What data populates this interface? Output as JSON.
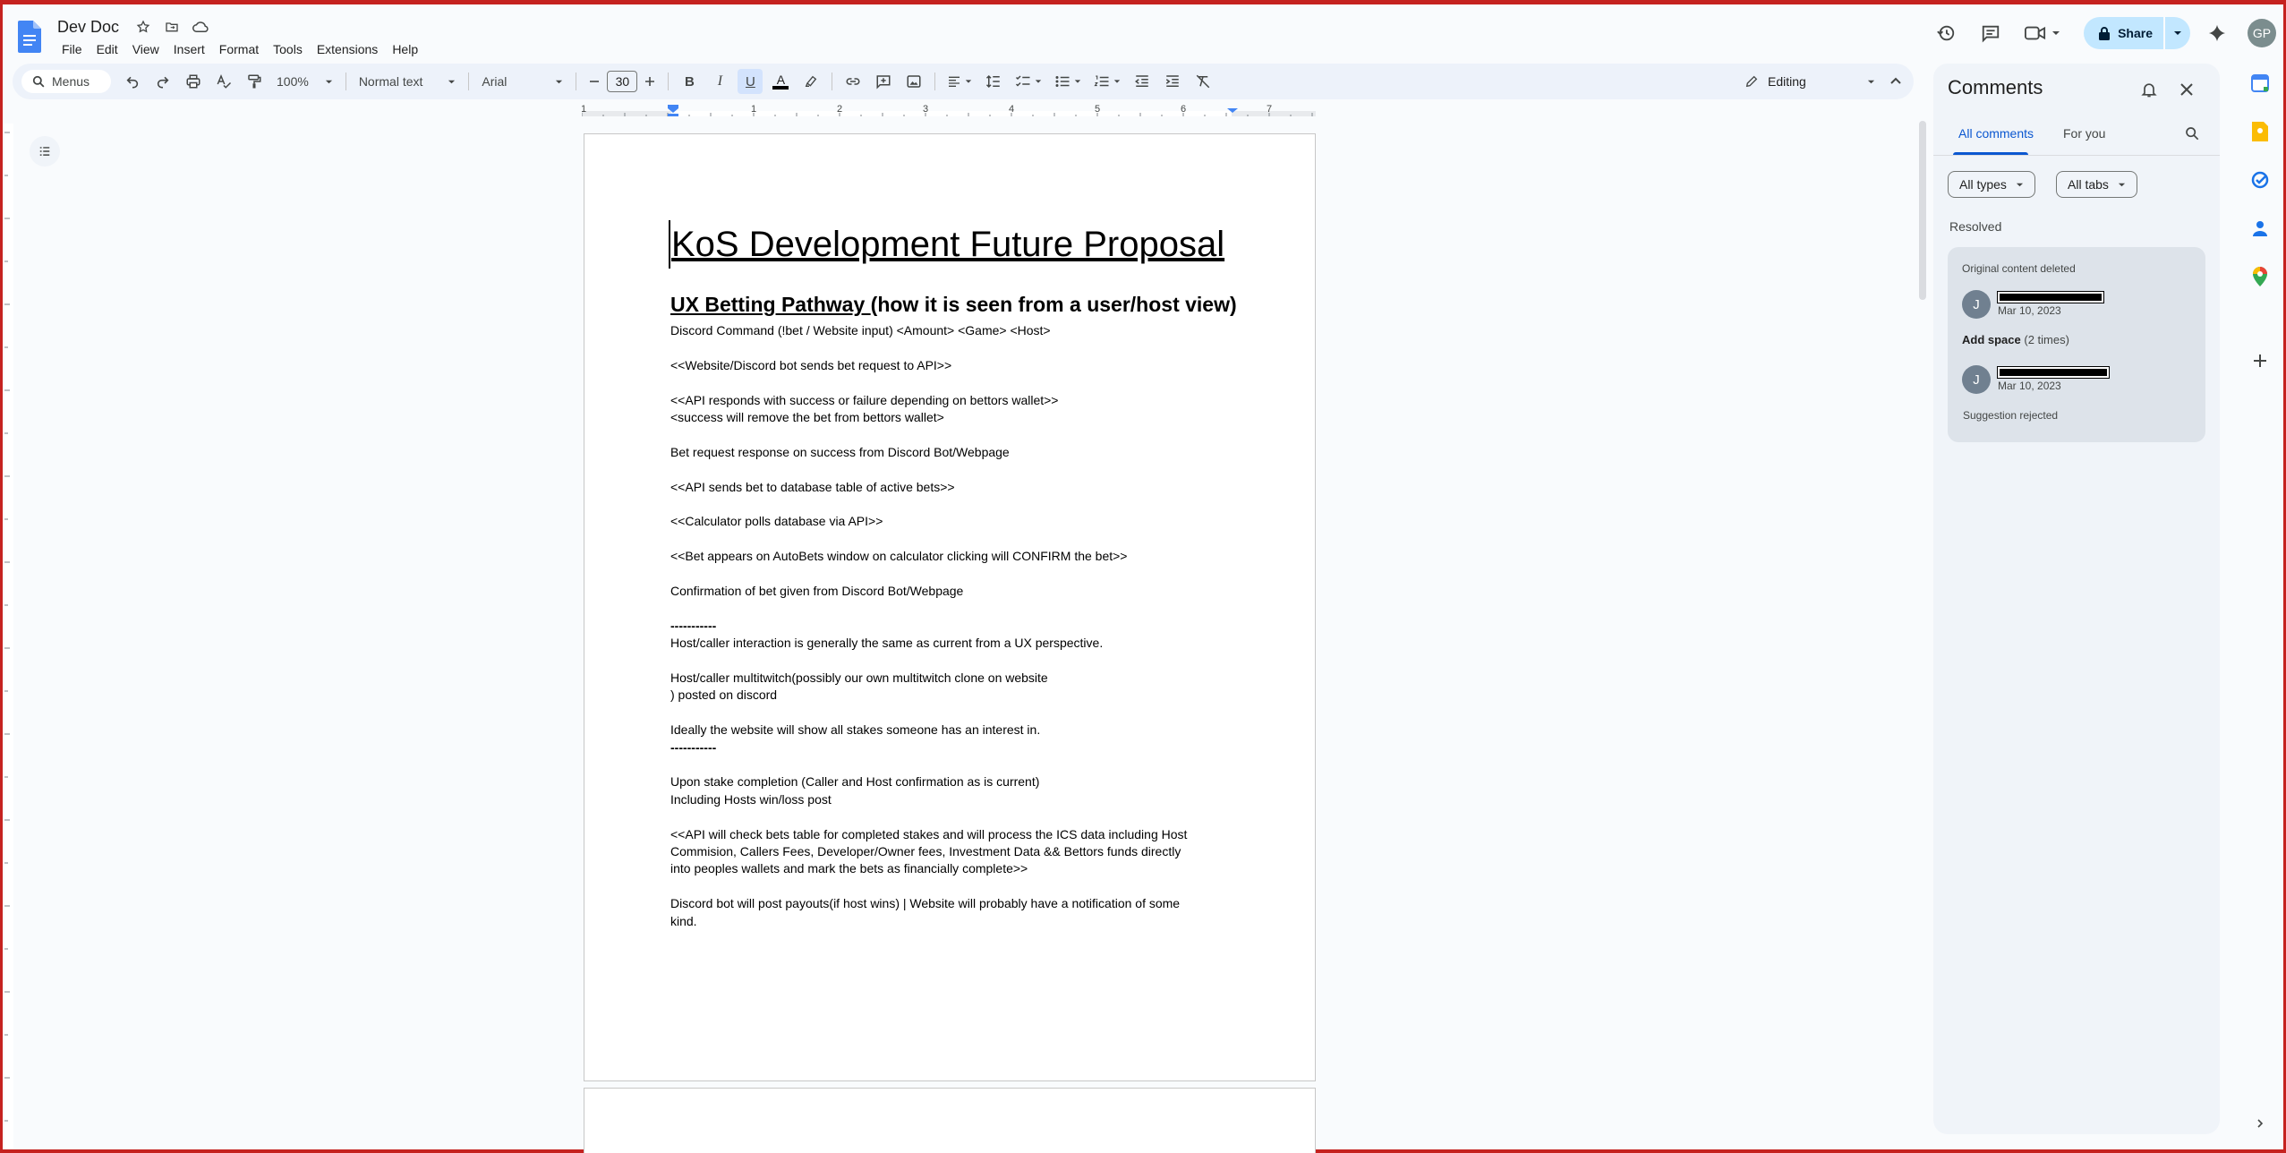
{
  "app": {
    "doc_title": "Dev Doc",
    "menu": [
      "File",
      "Edit",
      "View",
      "Insert",
      "Format",
      "Tools",
      "Extensions",
      "Help"
    ],
    "share_label": "Share",
    "avatar_initials": "GP"
  },
  "toolbar": {
    "menus_label": "Menus",
    "zoom": "100%",
    "style": "Normal text",
    "font": "Arial",
    "font_size": "30",
    "mode": "Editing"
  },
  "ruler": {
    "numbers": [
      "1",
      "1",
      "2",
      "3",
      "4",
      "5",
      "6",
      "7"
    ]
  },
  "document": {
    "title": "KoS Development Future Proposal",
    "heading_underlined": "UX Betting Pathway ",
    "heading_rest": "(how it is seen from a user/host view)",
    "lines": [
      {
        "text": "Discord Command (!bet / Website input) <Amount> <Game> <Host>",
        "bold": false
      },
      {
        "text": "",
        "bold": false
      },
      {
        "text": "<<Website/Discord bot sends bet request to API>>",
        "bold": false
      },
      {
        "text": "",
        "bold": false
      },
      {
        "text": "<<API responds with success or failure depending on bettors wallet>>",
        "bold": false
      },
      {
        "text": "<success will remove the bet from bettors wallet>",
        "bold": false
      },
      {
        "text": "",
        "bold": false
      },
      {
        "text": "Bet request response on success from Discord Bot/Webpage",
        "bold": false
      },
      {
        "text": "",
        "bold": false
      },
      {
        "text": "<<API sends bet to database table of active bets>>",
        "bold": false
      },
      {
        "text": "",
        "bold": false
      },
      {
        "text": "<<Calculator polls database via API>>",
        "bold": false
      },
      {
        "text": "",
        "bold": false
      },
      {
        "text": "<<Bet appears on AutoBets window on calculator clicking will CONFIRM the bet>>",
        "bold": false
      },
      {
        "text": "",
        "bold": false
      },
      {
        "text": "Confirmation of bet given from Discord Bot/Webpage",
        "bold": false
      },
      {
        "text": "",
        "bold": false
      },
      {
        "text": "-----------",
        "bold": true
      },
      {
        "text": "Host/caller interaction is generally the same as current from a UX perspective.",
        "bold": false
      },
      {
        "text": "",
        "bold": false
      },
      {
        "text": "Host/caller multitwitch(possibly our own multitwitch clone on website",
        "bold": false
      },
      {
        "text": ") posted on discord",
        "bold": false
      },
      {
        "text": "",
        "bold": false
      },
      {
        "text": "Ideally the website will show all stakes someone has an interest in.",
        "bold": false
      },
      {
        "text": "-----------",
        "bold": true
      },
      {
        "text": "",
        "bold": false
      },
      {
        "text": "Upon stake completion (Caller and Host confirmation as is current)",
        "bold": false
      },
      {
        "text": "Including Hosts win/loss post",
        "bold": false
      },
      {
        "text": "",
        "bold": false
      },
      {
        "text": "<<API will check bets table for completed stakes and will process the ICS data including Host",
        "bold": false
      },
      {
        "text": "Commision, Callers Fees, Developer/Owner fees, Investment Data && Bettors funds directly",
        "bold": false
      },
      {
        "text": "into peoples wallets and mark the bets as financially complete>>",
        "bold": false
      },
      {
        "text": "",
        "bold": false
      },
      {
        "text": "Discord bot will post payouts(if host wins) | Website will probably have a notification of some",
        "bold": false
      },
      {
        "text": "kind.",
        "bold": false
      }
    ]
  },
  "comments": {
    "title": "Comments",
    "tab_all": "All comments",
    "tab_you": "For you",
    "filter_types": "All types",
    "filter_tabs": "All tabs",
    "section": "Resolved",
    "card": {
      "status": "Original content deleted",
      "avatar1": "J",
      "date1": "Mar 10, 2023",
      "action": "Add space",
      "action_count": "(2 times)",
      "avatar2": "J",
      "date2": "Mar 10, 2023",
      "result": "Suggestion rejected"
    }
  },
  "colors": {
    "accent": "#0b57d0",
    "share_bg": "#c2e7ff",
    "frame": "#c5221f"
  }
}
